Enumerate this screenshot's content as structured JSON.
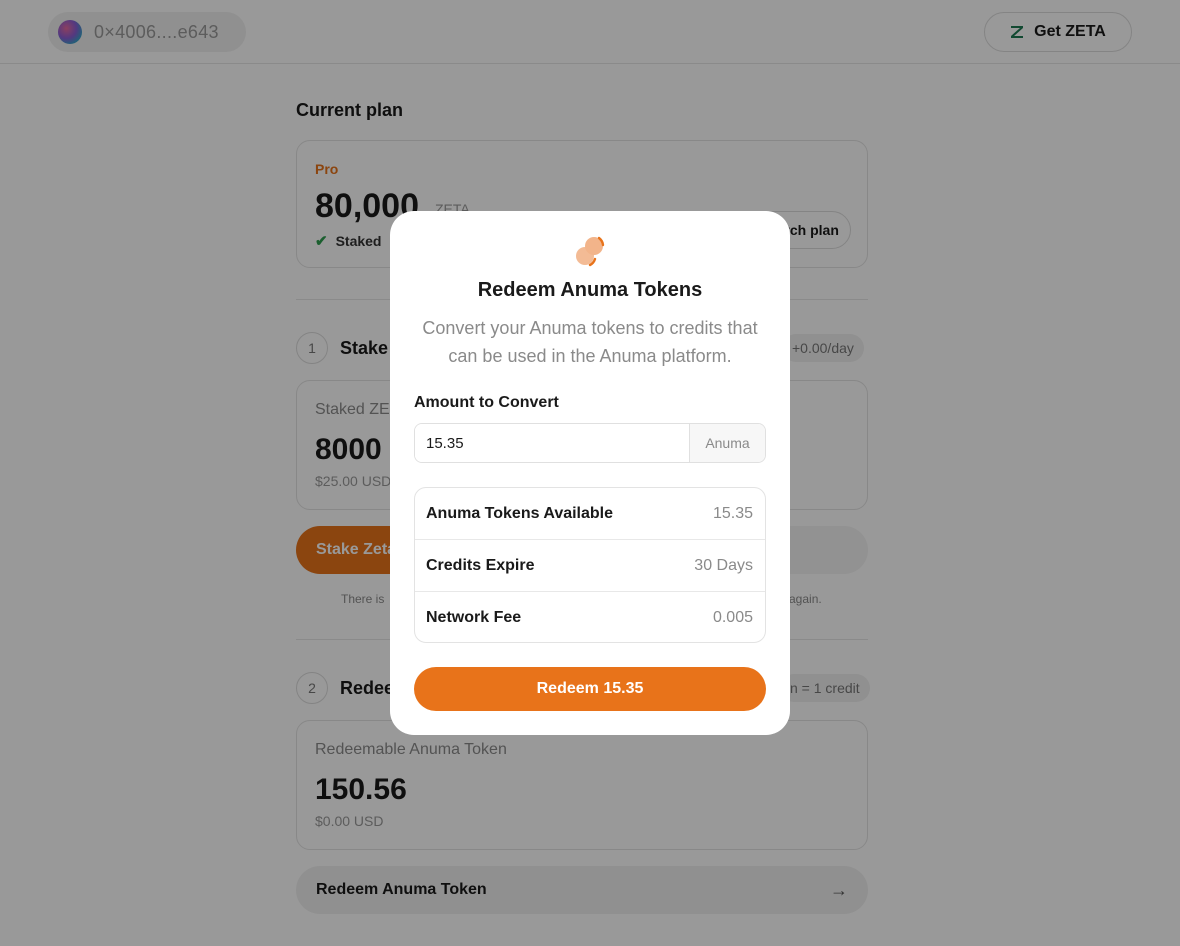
{
  "header": {
    "wallet_address": "0×4006....e643",
    "get_zeta_label": "Get ZETA"
  },
  "current_plan": {
    "section_title": "Current plan",
    "tier": "Pro",
    "amount": "80,000",
    "unit": "ZETA",
    "status": "Staked",
    "switch_label": "Switch plan"
  },
  "step1": {
    "number": "1",
    "title": "Stake",
    "rate": "+0.00/day",
    "card_label": "Staked ZE",
    "card_value": "8000",
    "card_usd": "$25.00 USD",
    "stake_button": "Stake Zeta",
    "note_left": "There is",
    "note_right": "again."
  },
  "step2": {
    "number": "2",
    "title": "Redee",
    "rate": "n = 1 credit",
    "card_label": "Redeemable Anuma Token",
    "card_value": "150.56",
    "card_usd": "$0.00 USD",
    "redeem_row_label": "Redeem Anuma Token"
  },
  "modal": {
    "title": "Redeem Anuma Tokens",
    "description": "Convert your Anuma tokens to credits that can be used in the Anuma platform.",
    "amount_label": "Amount to Convert",
    "amount_value": "15.35",
    "amount_suffix": "Anuma",
    "info": [
      {
        "key": "Anuma Tokens Available",
        "value": "15.35"
      },
      {
        "key": "Credits Expire",
        "value": "30 Days"
      },
      {
        "key": "Network Fee",
        "value": "0.005"
      }
    ],
    "redeem_button": "Redeem 15.35"
  },
  "colors": {
    "accent": "#e8731a",
    "success": "#2e9e4f",
    "overlay": "rgba(0,0,0,0.4)"
  }
}
